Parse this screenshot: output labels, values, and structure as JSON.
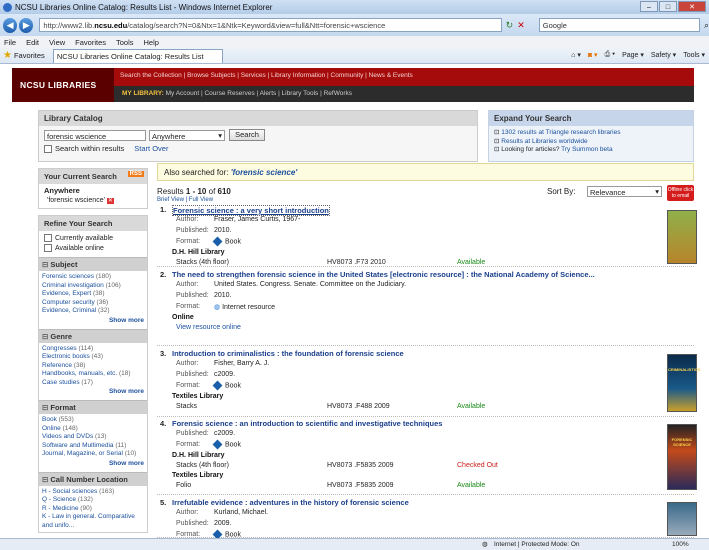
{
  "window": {
    "title": "NCSU Libraries Online Catalog: Results List - Windows Internet Explorer",
    "min": "–",
    "max": "□",
    "close": "✕"
  },
  "browser": {
    "url_prefix": "http://www2.lib.",
    "url_host": "ncsu.edu",
    "url_rest": "/catalog/search?N=0&Ntx=1&Ntk=Keyword&view=full&Ntt=forensic+wscience",
    "search_placeholder": "Google",
    "menu": [
      "File",
      "Edit",
      "View",
      "Favorites",
      "Tools",
      "Help"
    ],
    "favorites_label": "Favorites",
    "tab_title": "NCSU Libraries Online Catalog: Results List",
    "tools": [
      "Page ▾",
      "Safety ▾",
      "Tools ▾"
    ]
  },
  "header": {
    "logo": "NCSU LIBRARIES",
    "nav_top": "Search the Collection | Browse Subjects | Services | Library Information | Community | News & Events",
    "my_library_label": "MY LIBRARY:",
    "nav_my": "My Account | Course Reserves | Alerts | Library Tools | RefWorks"
  },
  "catalog": {
    "heading": "Library Catalog",
    "query": "forensic wscience",
    "scope": "Anywhere",
    "search_btn": "Search",
    "within": "Search within results",
    "start_over": "Start Over"
  },
  "expand": {
    "heading": "Expand Your Search",
    "items": [
      "1302 results at Triangle research libraries",
      "Results at Libraries worldwide",
      "Looking for articles?"
    ],
    "summon": "Try Summon beta"
  },
  "current": {
    "heading": "Your Current Search",
    "rss": "RSS",
    "field": "Anywhere",
    "term": "'forensic wscience'"
  },
  "refine": {
    "heading": "Refine Your Search",
    "opts": [
      "Currently available",
      "Available online"
    ],
    "groups": [
      {
        "name": "Subject",
        "items": [
          [
            "Forensic sciences",
            "(180)"
          ],
          [
            "Criminal investigation",
            "(106)"
          ],
          [
            "Evidence, Expert",
            "(38)"
          ],
          [
            "Computer security",
            "(36)"
          ],
          [
            "Evidence, Criminal",
            "(32)"
          ]
        ],
        "more": "Show more"
      },
      {
        "name": "Genre",
        "items": [
          [
            "Congresses",
            "(114)"
          ],
          [
            "Electronic books",
            "(43)"
          ],
          [
            "Reference",
            "(38)"
          ],
          [
            "Handbooks, manuals, etc.",
            "(18)"
          ],
          [
            "Case studies",
            "(17)"
          ]
        ],
        "more": "Show more"
      },
      {
        "name": "Format",
        "items": [
          [
            "Book",
            "(553)"
          ],
          [
            "Online",
            "(148)"
          ],
          [
            "Videos and DVDs",
            "(13)"
          ],
          [
            "Software and Multimedia",
            "(11)"
          ],
          [
            "Journal, Magazine, or Serial",
            "(10)"
          ]
        ],
        "more": "Show more"
      },
      {
        "name": "Call Number Location",
        "items": [
          [
            "H - Social sciences",
            "(163)"
          ],
          [
            "Q - Science",
            "(132)"
          ],
          [
            "R - Medicine",
            "(90)"
          ],
          [
            "K - Law in general. Comparative and unifo...",
            ""
          ]
        ],
        "more": ""
      }
    ]
  },
  "also": {
    "label": "Also searched for:",
    "term": "'forensic science'"
  },
  "results": {
    "summary_pre": "Results",
    "range": "1 - 10",
    "of": "of",
    "total": "610",
    "views": "Brief View | Full View",
    "sort_label": "Sort By:",
    "sort_value": "Relevance",
    "email": "Offline click to email",
    "records": [
      {
        "n": "1.",
        "title": "Forensic science : a very short introduction",
        "author": "Fraser, James Curtis, 1967-",
        "published": "2010.",
        "format": "Book",
        "library": "D.H. Hill Library",
        "holdings": [
          [
            "Stacks (4th floor)",
            "HV8073 .F73 2010",
            "Available"
          ]
        ]
      },
      {
        "n": "2.",
        "title": "The need to strengthen forensic science in the United States [electronic resource] : the National Academy of Science...",
        "author": "United States. Congress. Senate. Committee on the Judiciary.",
        "published": "2010.",
        "format": "Internet resource",
        "library": "Online",
        "holdings": [
          [
            "View resource online",
            "",
            ""
          ]
        ]
      },
      {
        "n": "3.",
        "title": "Introduction to criminalistics : the foundation of forensic science",
        "author": "Fisher, Barry A. J.",
        "published": "c2009.",
        "format": "Book",
        "library": "Textiles Library",
        "holdings": [
          [
            "Stacks",
            "HV8073 .F488 2009",
            "Available"
          ]
        ]
      },
      {
        "n": "4.",
        "title": "Forensic science : an introduction to scientific and investigative techniques",
        "author": "",
        "published": "c2009.",
        "format": "Book",
        "library": "D.H. Hill Library",
        "library2": "Textiles Library",
        "holdings": [
          [
            "Stacks (4th floor)",
            "HV8073 .F5835 2009",
            "Checked Out"
          ],
          [
            "Folio",
            "HV8073 .F5835 2009",
            "Available"
          ]
        ]
      },
      {
        "n": "5.",
        "title": "Irrefutable evidence : adventures in the history of forensic science",
        "author": "Kurland, Michael.",
        "published": "2009.",
        "format": "Book",
        "library": "",
        "holdings": []
      }
    ],
    "labels": {
      "author": "Author:",
      "published": "Published:",
      "format": "Format:"
    },
    "cover3": "CRIMINALISTICS",
    "cover4": "FORENSIC SCIENCE"
  },
  "status": {
    "zone": "Internet | Protected Mode: On",
    "zoom": "100%"
  },
  "colors": {
    "brand": "#a50b0b",
    "link": "#1a4f9c",
    "available": "#1a8a1a",
    "checkedout": "#cc1a1a"
  }
}
